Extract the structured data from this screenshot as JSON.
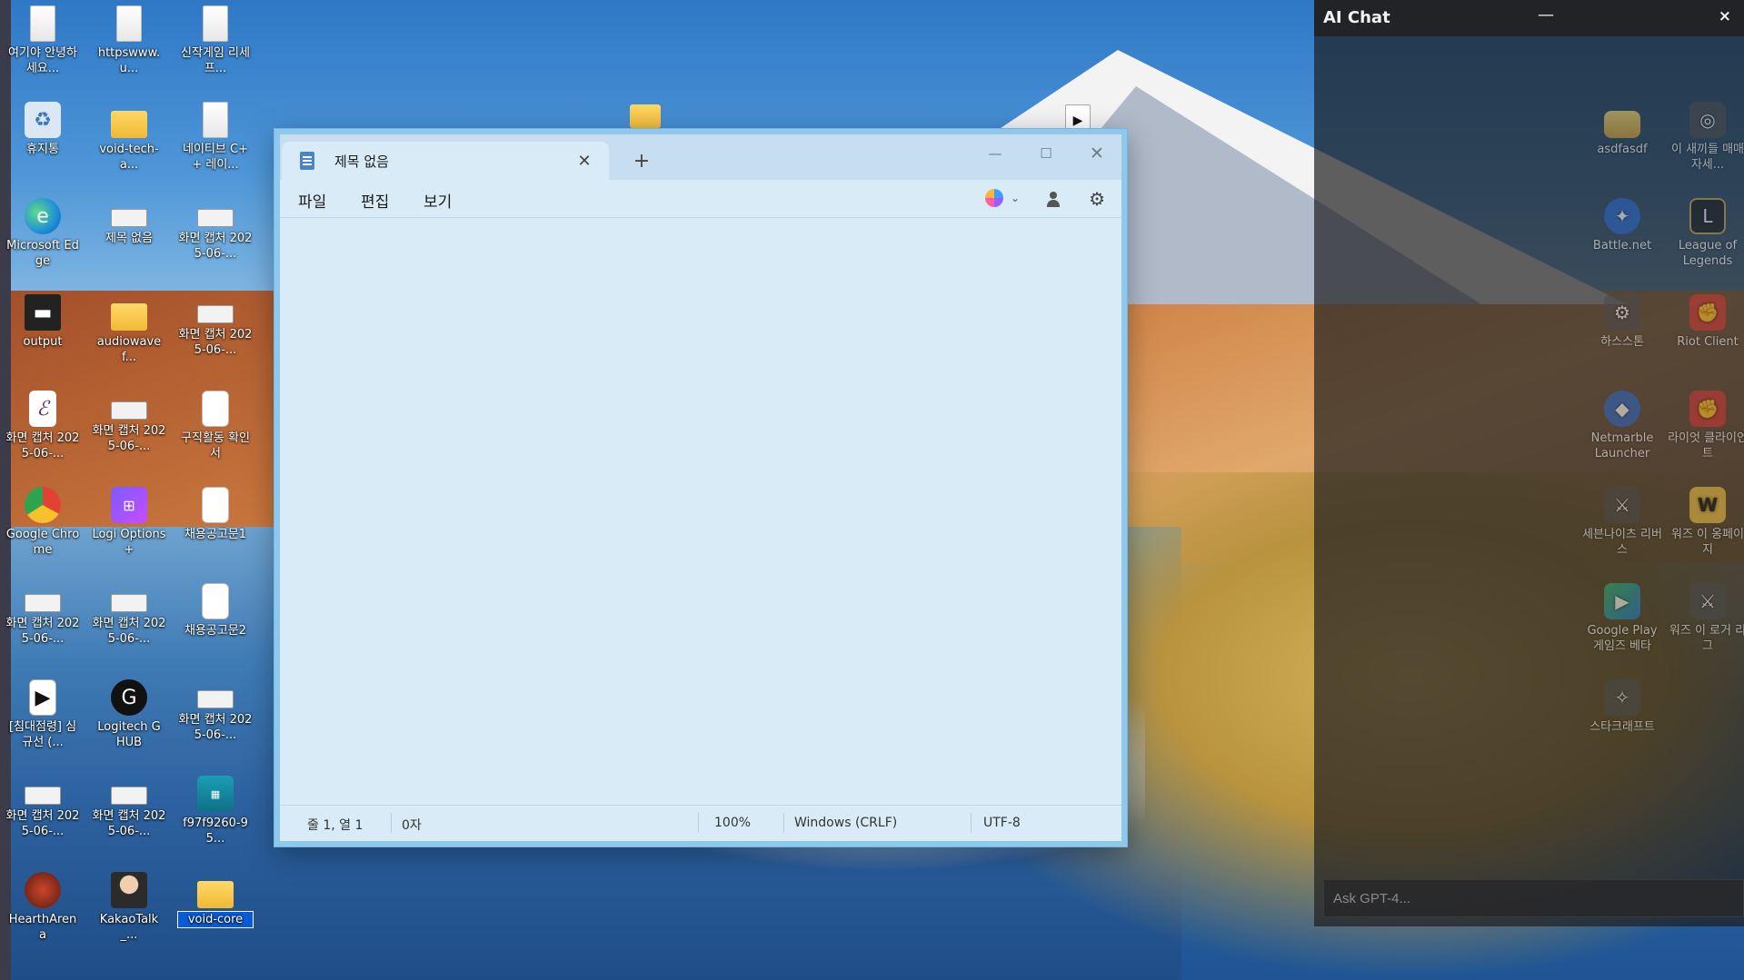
{
  "desktop": {
    "icons": [
      {
        "label": "여기야 안녕하세요...",
        "icon": "text-document-icon"
      },
      {
        "label": "httpswww.u...",
        "icon": "text-document-icon"
      },
      {
        "label": "신작게임 리세 프...",
        "icon": "text-document-icon"
      },
      {
        "label": "휴지통",
        "icon": "recycle-bin-icon"
      },
      {
        "label": "void-tech-a...",
        "icon": "folder-icon"
      },
      {
        "label": "네이티브 C++ 레이...",
        "icon": "text-document-icon"
      },
      {
        "label": "Microsoft Edge",
        "icon": "edge-icon"
      },
      {
        "label": "제목 없음",
        "icon": "screenshot-thumbnail-icon"
      },
      {
        "label": "화면 캡처 2025-06-...",
        "icon": "screenshot-thumbnail-icon"
      },
      {
        "label": "output",
        "icon": "video-icon"
      },
      {
        "label": "audiowavef...",
        "icon": "folder-icon"
      },
      {
        "label": "화면 캡처 2025-06-...",
        "icon": "screenshot-thumbnail-icon"
      },
      {
        "label": "화면 캡처 2025-06-...",
        "icon": "e-document-icon"
      },
      {
        "label": "화면 캡처 2025-06-...",
        "icon": "screenshot-thumbnail-icon"
      },
      {
        "label": "구직활동 확인서",
        "icon": "chrome-document-icon"
      },
      {
        "label": "Google Chrome",
        "icon": "chrome-icon"
      },
      {
        "label": "Logi Options+",
        "icon": "logi-options-icon"
      },
      {
        "label": "채용공고문1",
        "icon": "chrome-document-icon"
      },
      {
        "label": "화면 캡처 2025-06-...",
        "icon": "screenshot-thumbnail-icon"
      },
      {
        "label": "화면 캡처 2025-06-...",
        "icon": "screenshot-thumbnail-icon"
      },
      {
        "label": "채용공고문2",
        "icon": "chrome-document-icon"
      },
      {
        "label": "[침대점령] 심규선 (...",
        "icon": "media-file-icon"
      },
      {
        "label": "Logitech G HUB",
        "icon": "ghub-icon"
      },
      {
        "label": "화면 캡처 2025-06-...",
        "icon": "screenshot-thumbnail-icon"
      },
      {
        "label": "화면 캡처 2025-06-...",
        "icon": "screenshot-thumbnail-icon"
      },
      {
        "label": "화면 캡처 2025-06-...",
        "icon": "screenshot-thumbnail-icon"
      },
      {
        "label": "f97f9260-95...",
        "icon": "image-file-icon"
      },
      {
        "label": "HearthArena",
        "icon": "hearth-arena-icon"
      },
      {
        "label": "KakaoTalk_...",
        "icon": "photo-file-icon"
      },
      {
        "label": "void-core",
        "icon": "folder-icon"
      }
    ]
  },
  "notepad": {
    "tab_title": "제목 없음",
    "new_tab": "+",
    "menu": {
      "file": "파일",
      "edit": "편집",
      "view": "보기"
    },
    "status": {
      "position": "줄 1, 열 1",
      "chars": "0자",
      "zoom": "100%",
      "line_ending": "Windows (CRLF)",
      "encoding": "UTF-8"
    },
    "editor_text": ""
  },
  "ai_chat": {
    "title": "AI Chat",
    "minimize": "—",
    "close": "×",
    "input_placeholder": "Ask GPT-4...",
    "background_icons": [
      {
        "label": "asdfasdf",
        "icon": "folder-icon"
      },
      {
        "label": "이 새끼들 매매 자세...",
        "icon": "app-icon"
      },
      {
        "label": "Battle.net",
        "icon": "battlenet-icon"
      },
      {
        "label": "League of Legends",
        "icon": "lol-icon"
      },
      {
        "label": "하스스톤",
        "icon": "hearthstone-icon"
      },
      {
        "label": "Riot Client",
        "icon": "riot-icon"
      },
      {
        "label": "Netmarble Launcher",
        "icon": "netmarble-icon"
      },
      {
        "label": "라이엇 클라이언트",
        "icon": "riot-icon"
      },
      {
        "label": "세븐나이츠 리버스",
        "icon": "game-icon"
      },
      {
        "label": "워즈 이 옹페이지",
        "icon": "w-app-icon"
      },
      {
        "label": "Google Play 게임즈 베타",
        "icon": "google-play-games-icon"
      },
      {
        "label": "워즈 이 로거 리그",
        "icon": "game-icon"
      },
      {
        "label": "스타크래프트",
        "icon": "starcraft-icon"
      }
    ]
  }
}
